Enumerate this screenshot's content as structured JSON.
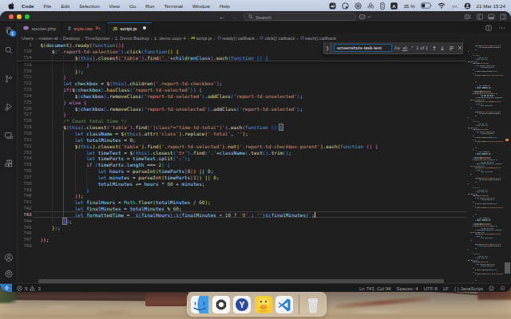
{
  "menu_bar": {
    "app_name": "Code",
    "items": [
      "File",
      "Edit",
      "Selection",
      "View",
      "Go",
      "Run",
      "Terminal",
      "Window",
      "Help"
    ],
    "status": {
      "battery_percent": "35 %",
      "input_source": "A",
      "clock": "21 Mar 15:24",
      "icons": [
        "screenshot-app-icon",
        "globe-icon",
        "knot-icon",
        "flower-icon",
        "widget-battery-icon",
        "input-source-badge",
        "battery-icon",
        "wifi-icon",
        "dots-icon",
        "user-switch-icon"
      ]
    }
  },
  "title_bar": {
    "search_placeholder": "Search",
    "window_controls": [
      "close",
      "minimize",
      "zoom"
    ],
    "nav": {
      "back": "←",
      "forward": "→"
    },
    "layout_icons": [
      "customize-layout-icon",
      "toggle-sidebar-icon",
      "toggle-panel-icon",
      "toggle-secondary-sidebar-icon"
    ]
  },
  "activity_bar": {
    "top": [
      "explorer",
      "search",
      "source-control",
      "run-debug",
      "remote-explorer",
      "extensions"
    ],
    "bottom": [
      "account",
      "settings"
    ],
    "explorer_badge": "1"
  },
  "tabs": [
    {
      "label": "spotter.php",
      "kind": "php",
      "active": false,
      "dirty": false,
      "badge": ""
    },
    {
      "label": "style.css",
      "kind": "css",
      "active": false,
      "dirty": false,
      "badge": "9+"
    },
    {
      "label": "script.js",
      "kind": "js",
      "active": true,
      "dirty": true,
      "badge": ""
    }
  ],
  "breadcrumbs": [
    {
      "label": "Users",
      "icon": ""
    },
    {
      "label": "master-al",
      "icon": ""
    },
    {
      "label": "Desktop",
      "icon": ""
    },
    {
      "label": "TimeSpotter",
      "icon": ""
    },
    {
      "label": "1. Demo Backup",
      "icon": ""
    },
    {
      "label": "1. demo copy 4",
      "icon": ""
    },
    {
      "label": "script.js",
      "icon": "js"
    },
    {
      "label": "ready() callback",
      "icon": "symbol"
    },
    {
      "label": "click() callback",
      "icon": "symbol"
    },
    {
      "label": "each() callback",
      "icon": "symbol"
    }
  ],
  "find_widget": {
    "query": "screenshots-task-text",
    "match_count": "1 of 1",
    "toggles": [
      "Aa",
      "ab",
      ".*"
    ],
    "buttons": [
      "previous-match",
      "next-match",
      "find-in-selection",
      "close"
    ]
  },
  "editor": {
    "sticky_lines": [
      {
        "num": "1",
        "text": "$(document).ready(function(){",
        "seed": 0
      },
      {
        "num": "710",
        "text": "    $('.report-td-selection').click(function() {",
        "seed": 2
      },
      {
        "num": "714",
        "text": "            $(this).closest('table').find('.'+childrenClass).each(function () {",
        "seed": 4
      }
    ],
    "lines": [
      {
        "num": "719",
        "text": "                }"
      },
      {
        "num": "720",
        "text": "            });"
      },
      {
        "num": "721",
        "text": "        }"
      },
      {
        "num": "722",
        "text": "        let checkbox = $(this).children('.report-td-checkbox');"
      },
      {
        "num": "723",
        "text": "        if($(checkbox).hasClass('report-td-selected')) {"
      },
      {
        "num": "724",
        "text": "            $(checkbox).removeClass('report-td-selected').addClass('report-td-unselected');"
      },
      {
        "num": "725",
        "text": "        } else {"
      },
      {
        "num": "726",
        "text": "            $(checkbox).removeClass('report-td-unselected').addClass('report-td-selected');"
      },
      {
        "num": "727",
        "text": "        }"
      },
      {
        "num": "728",
        "text": "        /* Count total time */"
      },
      {
        "num": "729",
        "text": "        $(this).closest('table').find('[class*=\"time-td-total\"]').each(function () {"
      },
      {
        "num": "730",
        "text": "            let className = $(this).attr('class').replace('-total', '');"
      },
      {
        "num": "731",
        "text": "            let totalMinutes = 0;"
      },
      {
        "num": "732",
        "text": "            $(this).closest('table').find('.report-td-selected').not('.report-td-checkbox-parent').each(function () {"
      },
      {
        "num": "733",
        "text": "                let timeText = $(this).closest('tr').find('.'+className).text().trim();"
      },
      {
        "num": "734",
        "text": "                let timeParts = timeText.split(':');"
      },
      {
        "num": "735",
        "text": "                if (timeParts.length === 2) {"
      },
      {
        "num": "736",
        "text": "                    let hours = parseInt(timeParts[0]) || 0;"
      },
      {
        "num": "737",
        "text": "                    let minutes = parseInt(timeParts[1]) || 0;"
      },
      {
        "num": "738",
        "text": "                    totalMinutes += hours * 60 + minutes;"
      },
      {
        "num": "739",
        "text": "                }"
      },
      {
        "num": "740",
        "text": "            });"
      },
      {
        "num": "741",
        "text": "            let finalHours = Math.floor(totalMinutes / 60);"
      },
      {
        "num": "742",
        "text": "            let finalMinutes = totalMinutes % 60;"
      },
      {
        "num": "743",
        "text": "            let formattedTime = `${finalHours}:${finalMinutes < 10 ? '0' : ''}${finalMinutes}`;"
      },
      {
        "num": "744",
        "text": "        });"
      },
      {
        "num": "745",
        "text": "    });"
      },
      {
        "num": "746",
        "text": ""
      },
      {
        "num": "747",
        "text": "});"
      },
      {
        "num": "748",
        "text": ""
      }
    ],
    "active_line": "743",
    "bracket_match_open_line": "729",
    "bracket_match_close_line": "744",
    "depth_seed": 8
  },
  "status_bar": {
    "remote_indicator": "><",
    "errors": "9",
    "warnings": "3",
    "line_col": "Ln 743, Col 96",
    "indentation": "Spaces: 4",
    "encoding": "UTF-8",
    "eol": "LF",
    "language_brackets": "{ }",
    "language": "JavaScript"
  },
  "dock": {
    "items": [
      "finder",
      "chatgpt",
      "yandex-browser",
      "cyberduck",
      "vscode",
      "trash"
    ],
    "yandex_letter": "Y"
  },
  "colors": {
    "accent_blue": "#2f7cd6",
    "editor_bg": "#1f1f20",
    "string": "#ce9178",
    "keyword": "#569cd6",
    "control": "#c586c0",
    "number": "#b5cea8",
    "function": "#dcdcaa",
    "variable": "#9cdcfe",
    "comment": "#6a9955",
    "class": "#4ec9b0",
    "error_label": "#e5766a",
    "bracket_gold": "#ffd700",
    "bracket_pink": "#da70d6",
    "bracket_blue": "#179fff"
  }
}
